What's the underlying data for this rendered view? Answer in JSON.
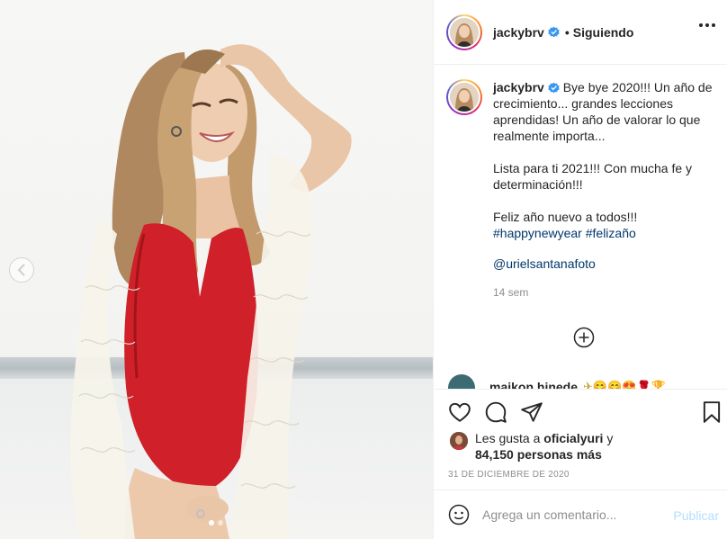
{
  "post": {
    "carousel": {
      "slide_count": 2,
      "active_slide": 1
    }
  },
  "header": {
    "username": "jackybrv",
    "separator": "•",
    "follow_status": "Siguiendo"
  },
  "caption": {
    "username": "jackybrv",
    "paragraphs": [
      "Bye bye 2020!!! Un año de crecimiento... grandes lecciones aprendidas! Un año de valorar lo que realmente importa...",
      "Lista para ti 2021!!! Con mucha fe y determinación!!!",
      "Feliz año nuevo a todos!!!"
    ],
    "hashtags": "#happynewyear #felizaño",
    "mention": "@urielsantanafoto",
    "time_ago": "14 sem"
  },
  "comment_preview": {
    "username": "maikon hinede",
    "emoji_text": "✈😊😊😍🌹🏆"
  },
  "likes": {
    "prefix": "Les gusta a",
    "user": "oficialyuri",
    "joiner": "y",
    "others": "84,150 personas más"
  },
  "date": "31 DE DICIEMBRE DE 2020",
  "comment_box": {
    "placeholder": "Agrega un comentario...",
    "post_label": "Publicar"
  },
  "icons": {
    "verified": "verified-badge-icon",
    "more": "more-options-icon",
    "like": "heart-icon",
    "comment": "comment-bubble-icon",
    "share": "paper-plane-icon",
    "save": "bookmark-icon",
    "emoji": "smiley-icon",
    "load_more": "plus-circle-icon",
    "carousel_prev": "chevron-left-icon"
  },
  "colors": {
    "verified_blue": "#3897f0",
    "link_blue": "#00376b",
    "muted_gray": "#8e8e8e",
    "post_button_disabled": "#b2dffc",
    "swimsuit_red": "#d0202a"
  }
}
